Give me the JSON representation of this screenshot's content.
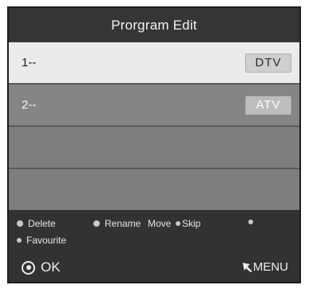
{
  "window": {
    "title": "Prorgram Edit"
  },
  "programs": [
    {
      "label": "1--",
      "type": "DTV"
    },
    {
      "label": "2--",
      "type": "ATV"
    }
  ],
  "options": {
    "delete": "Delete",
    "rename": "Rename",
    "move": "Move",
    "skip": "Skip",
    "favourite": "Favourite"
  },
  "footer": {
    "ok_label": "OK",
    "menu_label": "MENU"
  },
  "colors": {
    "selected_row": "#ebebeb",
    "row": "#858585",
    "panel": "#323232"
  }
}
